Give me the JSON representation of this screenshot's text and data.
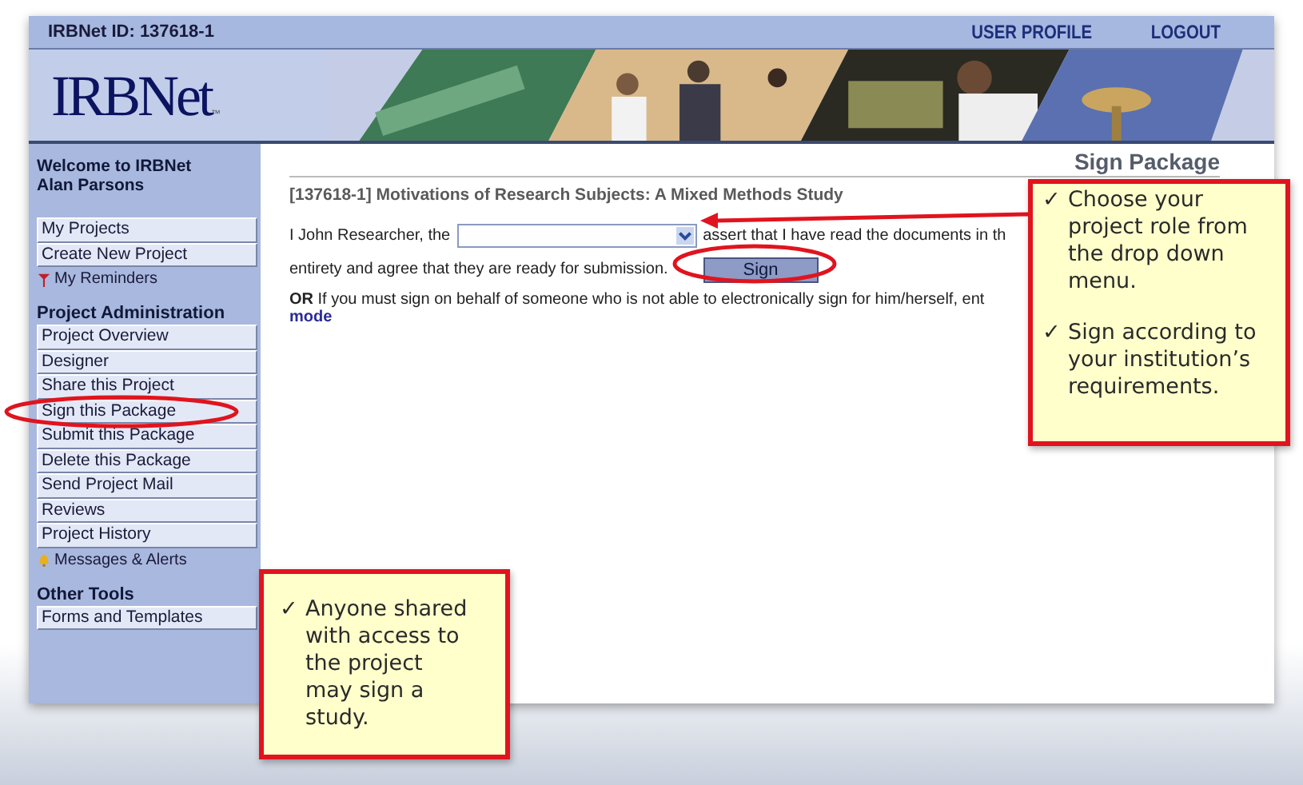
{
  "header": {
    "id_label": "IRBNet ID: 137618-1",
    "links": [
      {
        "label": "USER PROFILE"
      },
      {
        "label": "LOGOUT"
      }
    ]
  },
  "banner": {
    "logo": "IRBNet",
    "trademark": "™"
  },
  "sidebar": {
    "welcome": "Welcome to IRBNet",
    "user": "Alan Parsons",
    "groups": [
      {
        "items": [
          {
            "label": "My Projects",
            "kind": "button"
          },
          {
            "label": "Create New Project",
            "kind": "button"
          },
          {
            "label": "My Reminders",
            "kind": "flag-link"
          }
        ]
      },
      {
        "heading": "Project Administration",
        "items": [
          {
            "label": "Project Overview",
            "kind": "button"
          },
          {
            "label": "Designer",
            "kind": "button"
          },
          {
            "label": "Share this Project",
            "kind": "button"
          },
          {
            "label": "Sign this Package",
            "kind": "button"
          },
          {
            "label": "Submit this Package",
            "kind": "button"
          },
          {
            "label": "Delete this Package",
            "kind": "button"
          },
          {
            "label": "Send Project Mail",
            "kind": "button"
          },
          {
            "label": "Reviews",
            "kind": "button"
          },
          {
            "label": "Project History",
            "kind": "button"
          },
          {
            "label": "Messages & Alerts",
            "kind": "bell-link"
          }
        ]
      },
      {
        "heading": "Other Tools",
        "items": [
          {
            "label": "Forms and Templates",
            "kind": "button"
          }
        ]
      }
    ]
  },
  "main": {
    "page_title": "Sign Package",
    "project_title": "[137618-1] Motivations of Research Subjects: A Mixed Methods Study",
    "statement_before": "I John Researcher, the",
    "statement_after": "assert that I have read the documents in th",
    "statement_line2": "entirety and agree that they are ready for submission.",
    "sign_button": "Sign",
    "alternative": "**OR** If you must sign on behalf of someone who is not able to electronically sign for him/herself, ent",
    "alternative_link": "mode"
  },
  "callouts": [
    {
      "items": [
        {
          "mark": "✓",
          "text": "Choose your project role from the drop down menu."
        },
        {
          "mark": "✓",
          "text": "Sign according to your institution’s requirements."
        }
      ]
    },
    {
      "items": [
        {
          "mark": "✓",
          "text": "Anyone shared with access to the project may sign a study."
        }
      ]
    }
  ]
}
